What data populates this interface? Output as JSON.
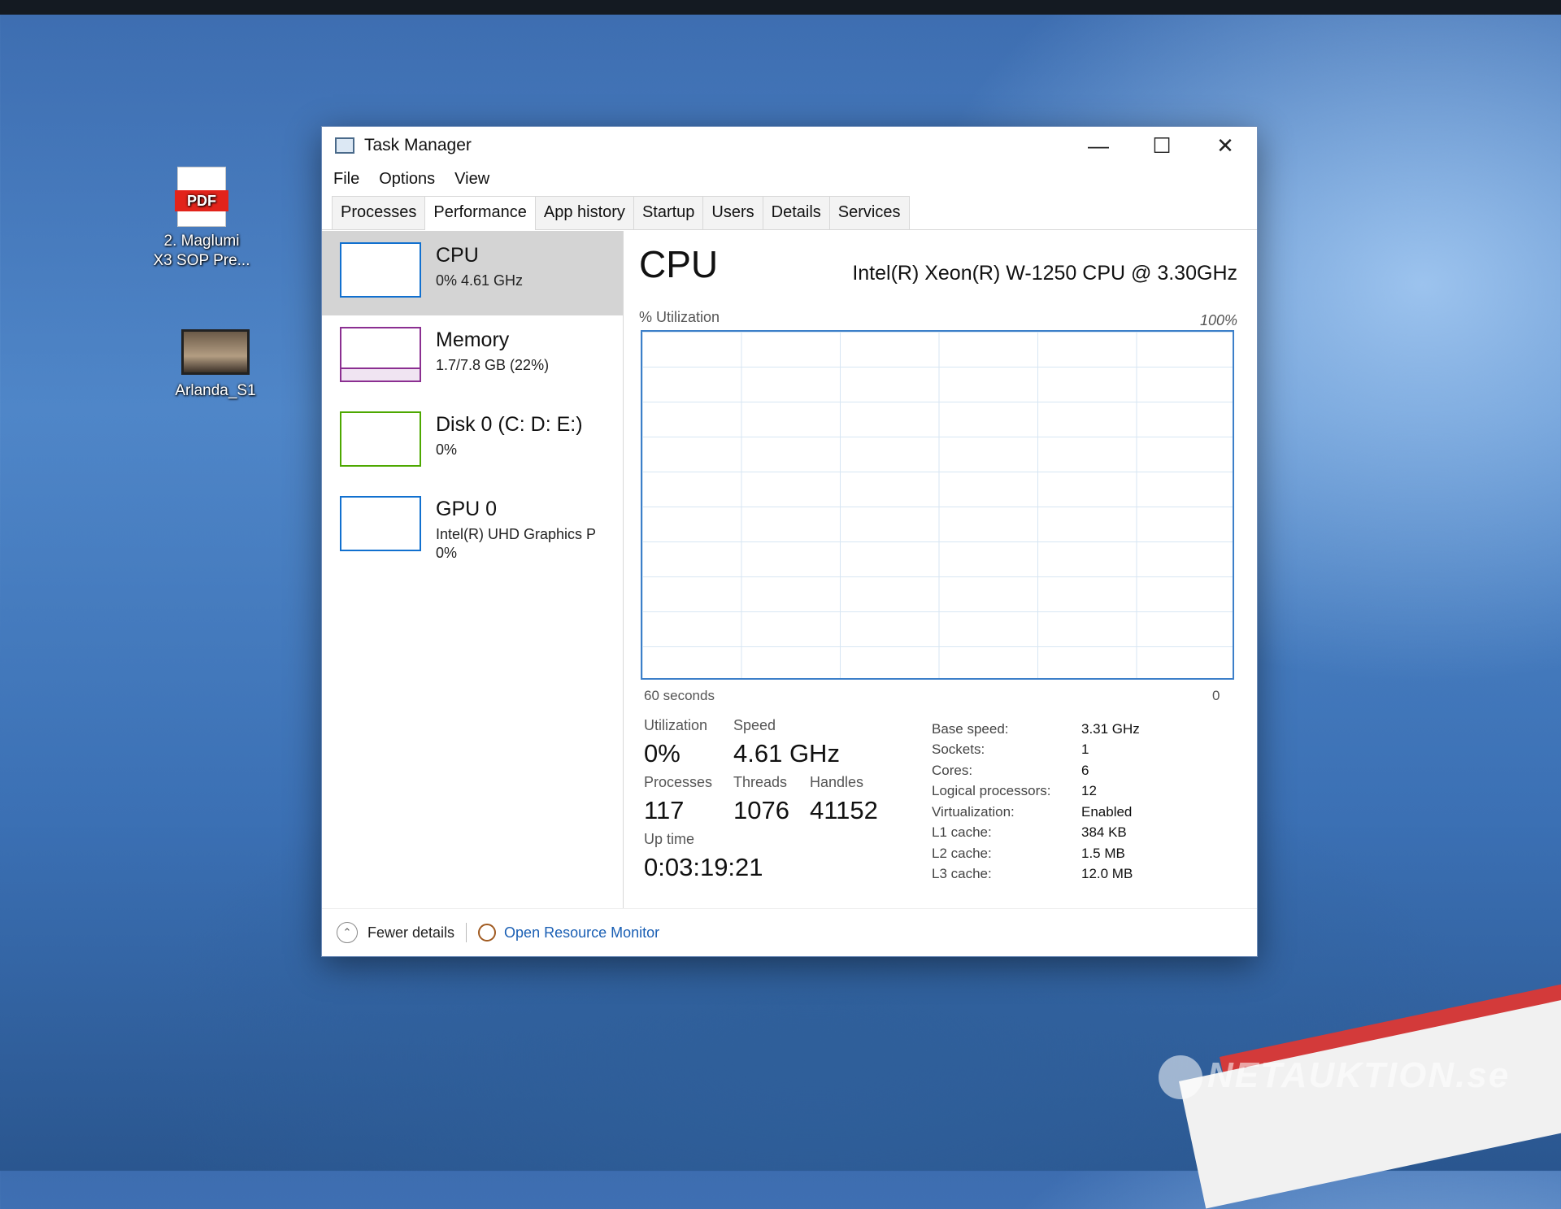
{
  "desktop": {
    "icons": [
      {
        "label_line1": "2. Maglumi",
        "label_line2": "X3 SOP Pre...",
        "badge": "PDF",
        "icon": "pdf-file-icon"
      },
      {
        "label": "Arlanda_S1",
        "icon": "video-file-icon"
      }
    ],
    "watermark": "NETAUKTION.se"
  },
  "window": {
    "title": "Task Manager",
    "controls": {
      "minimize": "—",
      "maximize": "☐",
      "close": "✕"
    }
  },
  "menu": [
    "File",
    "Options",
    "View"
  ],
  "tabs": [
    "Processes",
    "Performance",
    "App history",
    "Startup",
    "Users",
    "Details",
    "Services"
  ],
  "active_tab": "Performance",
  "sidebar": [
    {
      "title": "CPU",
      "sub": "0% 4.61 GHz",
      "color": "#1170cf"
    },
    {
      "title": "Memory",
      "sub": "1.7/7.8 GB (22%)",
      "color": "#8b2f91",
      "used_fraction": 0.22
    },
    {
      "title": "Disk 0 (C: D: E:)",
      "sub": "0%",
      "color": "#4da800"
    },
    {
      "title": "GPU 0",
      "sub": "Intel(R) UHD Graphics P",
      "sub2": "0%",
      "color": "#1170cf"
    }
  ],
  "cpu": {
    "heading": "CPU",
    "model": "Intel(R) Xeon(R) W-1250 CPU @ 3.30GHz",
    "util_label": "% Utilization",
    "max_label": "100%",
    "time_label": "60 seconds",
    "zero_label": "0",
    "stats": {
      "utilization": {
        "label": "Utilization",
        "value": "0%"
      },
      "speed": {
        "label": "Speed",
        "value": "4.61 GHz"
      },
      "processes": {
        "label": "Processes",
        "value": "117"
      },
      "threads": {
        "label": "Threads",
        "value": "1076"
      },
      "handles": {
        "label": "Handles",
        "value": "41152"
      },
      "uptime": {
        "label": "Up time",
        "value": "0:03:19:21"
      }
    },
    "specs": [
      {
        "k": "Base speed:",
        "v": "3.31 GHz"
      },
      {
        "k": "Sockets:",
        "v": "1"
      },
      {
        "k": "Cores:",
        "v": "6"
      },
      {
        "k": "Logical processors:",
        "v": "12"
      },
      {
        "k": "Virtualization:",
        "v": "Enabled"
      },
      {
        "k": "L1 cache:",
        "v": "384 KB"
      },
      {
        "k": "L2 cache:",
        "v": "1.5 MB"
      },
      {
        "k": "L3 cache:",
        "v": "12.0 MB"
      }
    ]
  },
  "footer": {
    "fewer_details": "Fewer details",
    "open_resource_monitor": "Open Resource Monitor"
  }
}
